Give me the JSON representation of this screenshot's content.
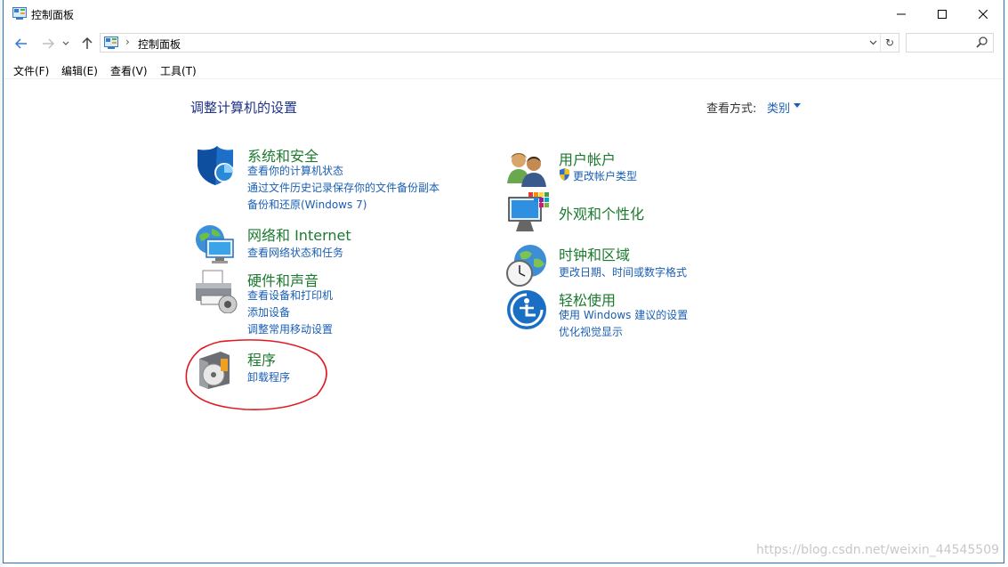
{
  "window": {
    "title": "控制面板"
  },
  "address": {
    "path": "控制面板",
    "separator": "›"
  },
  "search": {
    "placeholder": ""
  },
  "menu": [
    "文件(F)",
    "编辑(E)",
    "查看(V)",
    "工具(T)"
  ],
  "content": {
    "heading": "调整计算机的设置",
    "view_by_label": "查看方式:",
    "view_by_value": "类别"
  },
  "categories": {
    "system_security": {
      "title": "系统和安全",
      "links": [
        "查看你的计算机状态",
        "通过文件历史记录保存你的文件备份副本",
        "备份和还原(Windows 7)"
      ]
    },
    "network": {
      "title": "网络和 Internet",
      "links": [
        "查看网络状态和任务"
      ]
    },
    "hardware": {
      "title": "硬件和声音",
      "links": [
        "查看设备和打印机",
        "添加设备",
        "调整常用移动设置"
      ]
    },
    "programs": {
      "title": "程序",
      "links": [
        "卸载程序"
      ]
    },
    "user_accounts": {
      "title": "用户帐户",
      "links": [
        "更改帐户类型"
      ]
    },
    "appearance": {
      "title": "外观和个性化",
      "links": []
    },
    "clock_region": {
      "title": "时钟和区域",
      "links": [
        "更改日期、时间或数字格式"
      ]
    },
    "ease_access": {
      "title": "轻松使用",
      "links": [
        "使用 Windows 建议的设置",
        "优化视觉显示"
      ]
    }
  },
  "watermark": "https://blog.csdn.net/weixin_44545509",
  "colors": {
    "title_green": "#1b7a2e",
    "link_blue": "#1a5fb4",
    "heading_blue": "#1e3287",
    "annotation_red": "#e0191f"
  }
}
